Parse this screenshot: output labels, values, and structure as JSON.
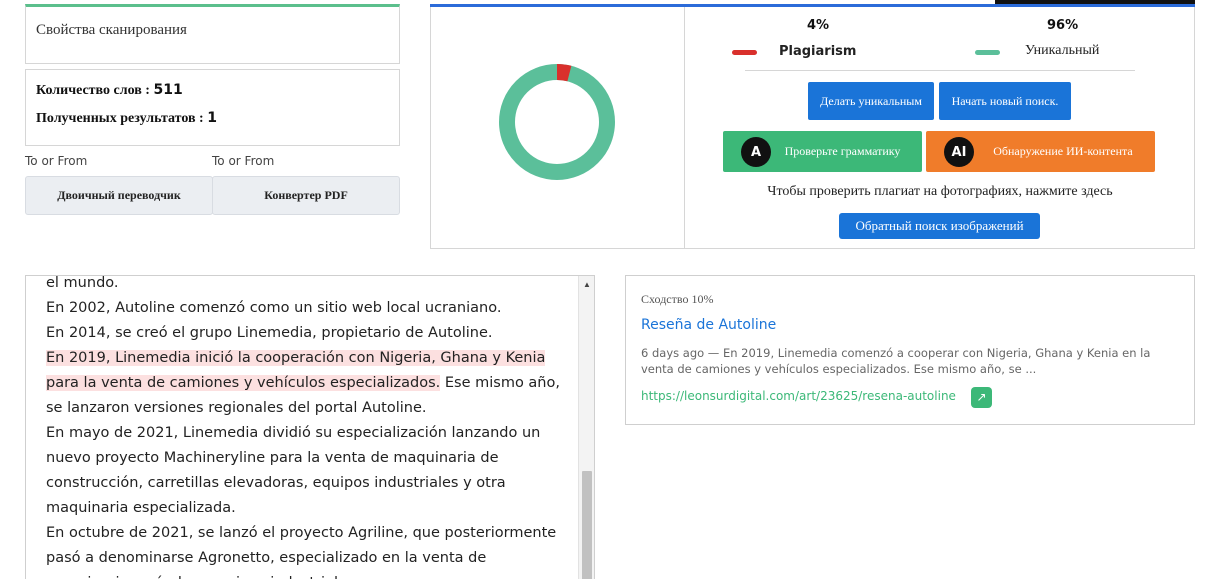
{
  "scan": {
    "title": "Свойства сканирования",
    "words_label": "Количество слов : ",
    "words_value": "511",
    "results_label": "Полученных результатов : ",
    "results_value": "1"
  },
  "tools": [
    {
      "caption": "To or From",
      "label": "Двоичный переводчик"
    },
    {
      "caption": "To or From",
      "label": "Конвертер PDF"
    }
  ],
  "result": {
    "plagiarism_pct": "4%",
    "unique_pct": "96%",
    "plagiarism_label": "Plagiarism",
    "unique_label": "Уникальный",
    "plagiarism_fraction": 0.04,
    "colors": {
      "plagiarism": "#d9302c",
      "unique": "#5bbf9a"
    },
    "buttons": {
      "make_unique": "Делать уникальным",
      "new_search": "Начать новый поиск.",
      "grammar": "Проверьте грамматику",
      "ai_detect": "Обнаружение ИИ-контента",
      "reverse_image": "Обратный поиск изображений"
    },
    "grammar_icon_text": "A",
    "ai_icon_text": "AI",
    "photo_note": "Чтобы проверить плагиат на фотографиях, нажмите здесь"
  },
  "text": {
    "lines": [
      "el mundo.",
      "En 2002, Autoline comenzó como un sitio web local ucraniano.",
      "En 2014, se creó el grupo Linemedia, propietario de Autoline."
    ],
    "highlighted": " En 2019, Linemedia inició la cooperación con Nigeria, Ghana y Kenia para la venta de camiones y vehículos especializados.",
    "after_highlight": " Ese mismo año, se lanzaron versiones regionales del portal Autoline.",
    "para2": " En mayo de 2021, Linemedia dividió su especialización lanzando un nuevo proyecto Machineryline para la venta de maquinaria de construcción, carretillas elevadoras, equipos industriales y otra maquinaria especializada.",
    "para3": " En octubre de 2021, se lanzó el proyecto Agriline, que posteriormente pasó a denominarse Agronetto, especializado en la venta de maquinaria agrícola y equipos industriales."
  },
  "source": {
    "similarity": "Сходство 10%",
    "title": "Reseña de Autoline",
    "snippet": "6 days ago — En 2019, Linemedia comenzó a cooperar con Nigeria, Ghana y Kenia en la venta de camiones y vehículos especializados. Ese mismo año, se ...",
    "url": "https://leonsurdigital.com/art/23625/resena-autoline"
  }
}
